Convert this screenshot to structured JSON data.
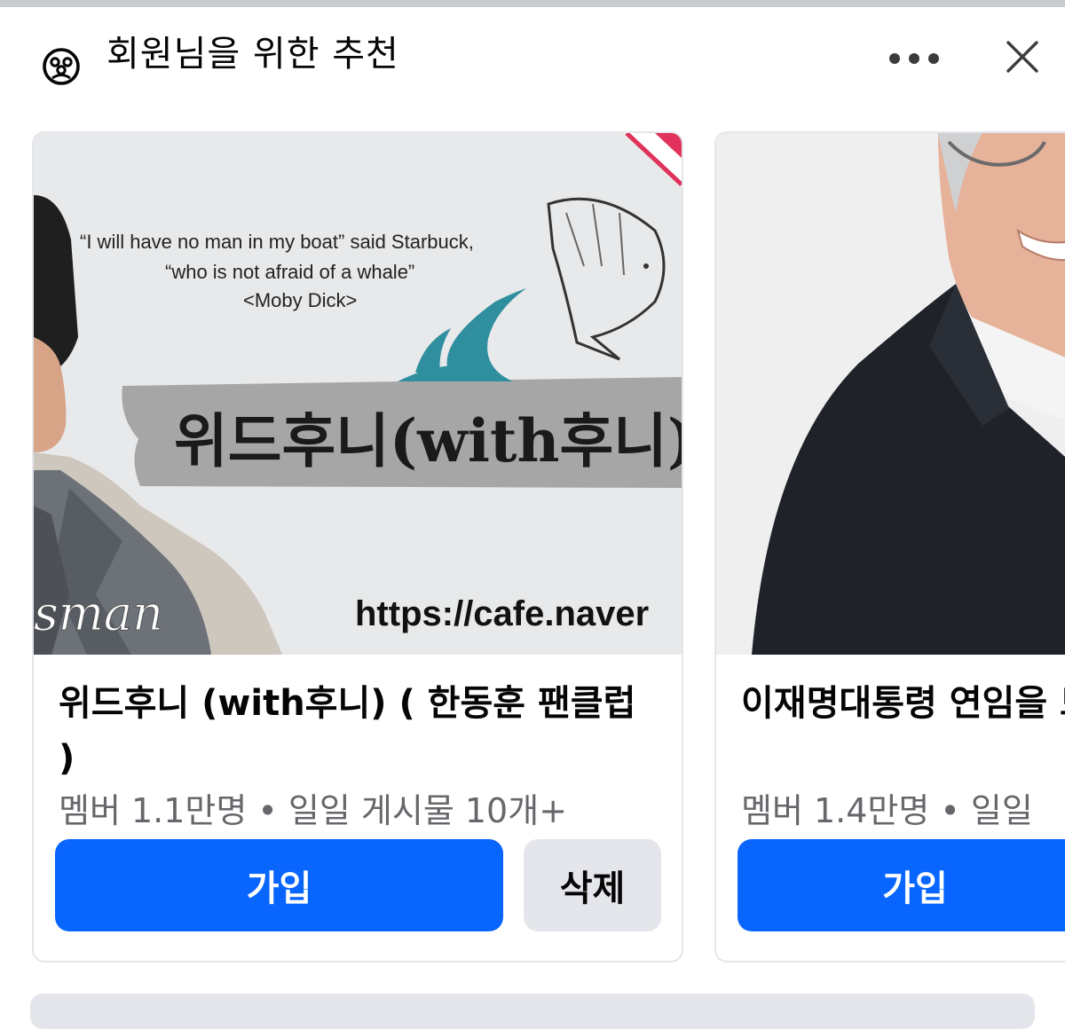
{
  "header": {
    "title": "회원님을 위한 추천"
  },
  "cards": [
    {
      "image_text": {
        "quote_line1": "“I will have no man in my boat” said Starbuck,",
        "quote_line2": "“who is not afraid of a whale”",
        "quote_source": "<Moby Dick>",
        "banner": "위드후니(with후니)(한동",
        "url": "https://cafe.naver",
        "script": "sman"
      },
      "title": "위드후니 (with후니) ( 한동훈 팬클럽 )",
      "meta": "멤버 1.1만명 • 일일 게시물 10개+",
      "join_label": "가입",
      "delete_label": "삭제"
    },
    {
      "title": "이재명대통령 연임을 모임",
      "meta": "멤버 1.4만명 • 일일",
      "join_label": "가입"
    }
  ],
  "colors": {
    "primary": "#0866ff",
    "secondary_button": "#e4e6eb",
    "meta_text": "#65676b",
    "accent_wave": "#2f8f9e"
  },
  "icons": [
    "group-icon",
    "more-icon",
    "close-icon"
  ]
}
